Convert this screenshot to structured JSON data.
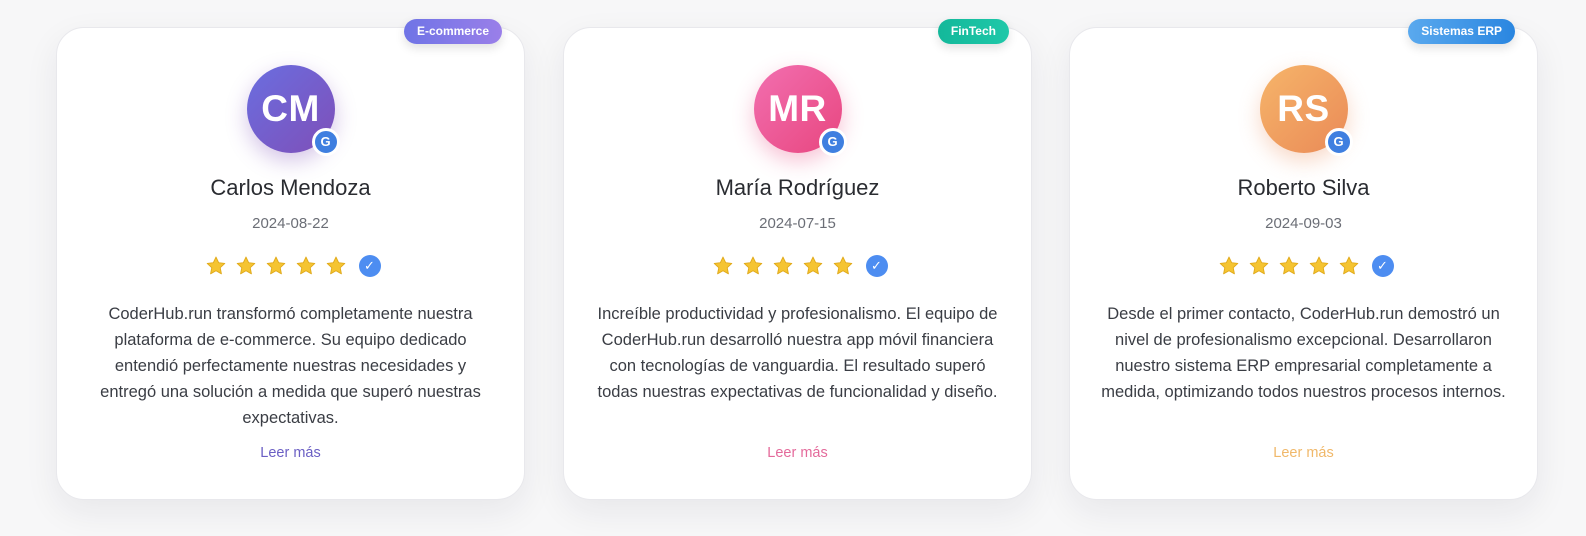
{
  "reviews": [
    {
      "initials": "CM",
      "name": "Carlos Mendoza",
      "date": "2024-08-22",
      "category": "E-commerce",
      "rating": 5,
      "text": "CoderHub.run transformó completamente nuestra plataforma de e-commerce. Su equipo dedicado entendió perfectamente nuestras necesidades y entregó una solución a medida que superó nuestras expectativas.",
      "read_more": "Leer más",
      "avatar_colors": [
        "#6a6ee0",
        "#7f4fb8"
      ],
      "tag_colors": [
        "#6f74e6",
        "#9a7fe9"
      ],
      "link_color": "#6b5fc4"
    },
    {
      "initials": "MR",
      "name": "María Rodríguez",
      "date": "2024-07-15",
      "category": "FinTech",
      "rating": 5,
      "text": "Increíble productividad y profesionalismo. El equipo de CoderHub.run desarrolló nuestra app móvil financiera con tecnologías de vanguardia. El resultado superó todas nuestras expectativas de funcionalidad y diseño.",
      "read_more": "Leer más",
      "avatar_colors": [
        "#f26fb0",
        "#e8467f"
      ],
      "tag_colors": [
        "#13b89a",
        "#1fc8a9"
      ],
      "link_color": "#e46a9b"
    },
    {
      "initials": "RS",
      "name": "Roberto Silva",
      "date": "2024-09-03",
      "category": "Sistemas ERP",
      "rating": 5,
      "text": "Desde el primer contacto, CoderHub.run demostró un nivel de profesionalismo excepcional. Desarrollaron nuestro sistema ERP empresarial completamente a medida, optimizando todos nuestros procesos internos.",
      "read_more": "Leer más",
      "avatar_colors": [
        "#f6b56a",
        "#ea8a57"
      ],
      "tag_colors": [
        "#5aa9ee",
        "#2a86e0"
      ],
      "link_color": "#f0b86a"
    }
  ],
  "badge_letter": "G",
  "verified_mark": "✓",
  "icons": {
    "badge": "google-icon",
    "rating": "star-icon",
    "verified": "check-circle-icon"
  }
}
